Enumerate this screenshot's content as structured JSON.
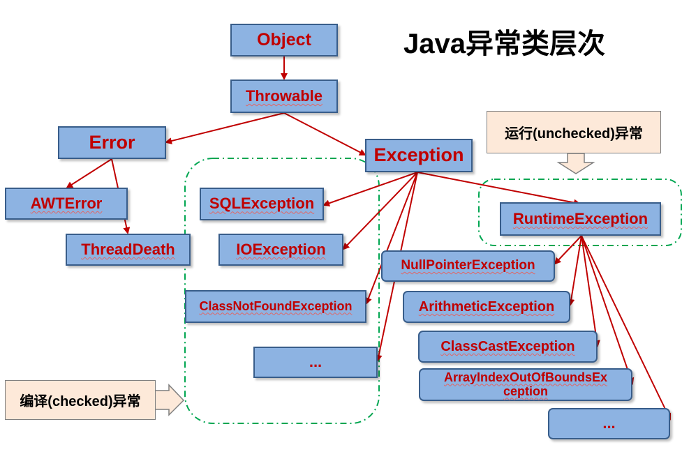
{
  "title": "Java异常类层次",
  "colors": {
    "box_fill": "#8db3e2",
    "box_border": "#385d8a",
    "label": "#c00000",
    "arrow": "#c00000",
    "group_border": "#00a651",
    "callout_fill": "#fde9d9"
  },
  "nodes": {
    "object": "Object",
    "throwable": "Throwable",
    "error": "Error",
    "exception": "Exception",
    "awt_error": "AWTError",
    "thread_death": "ThreadDeath",
    "sql_exception": "SQLException",
    "io_exception": "IOException",
    "class_not_found": "ClassNotFoundException",
    "checked_more": "...",
    "runtime_exception": "RuntimeException",
    "null_pointer": "NullPointerException",
    "arithmetic": "ArithmeticException",
    "class_cast": "ClassCastException",
    "array_index_line1": "ArrayIndexOutOfBoundsEx",
    "array_index_line2": "ception",
    "unchecked_more": "..."
  },
  "callouts": {
    "unchecked": "运行(unchecked)异常",
    "checked": "编译(checked)异常"
  }
}
